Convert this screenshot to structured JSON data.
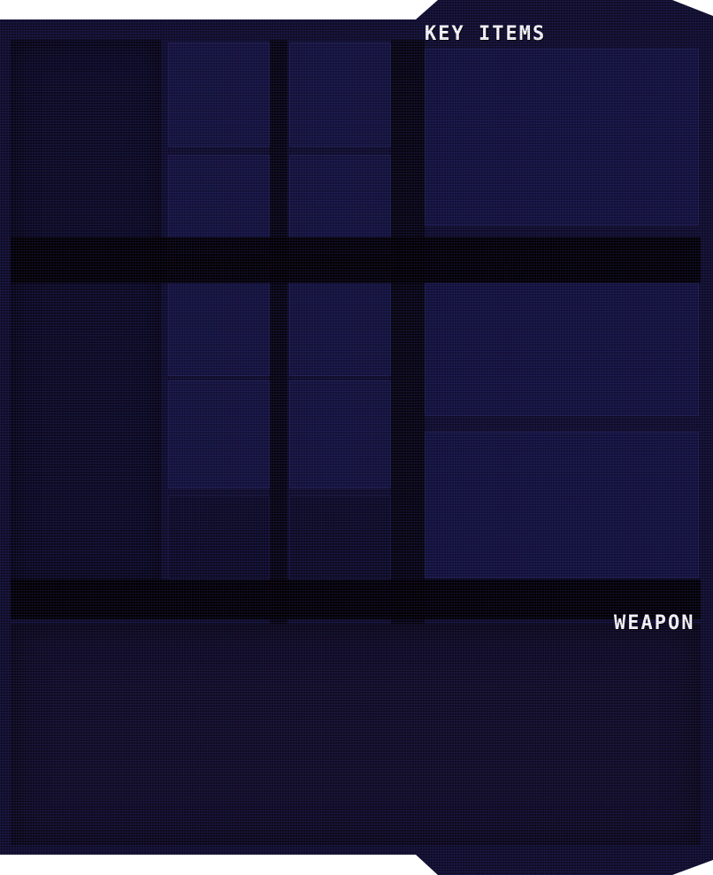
{
  "inventory": {
    "key_items_label": "KEY ITEMS",
    "weapon_label": "WEAPON",
    "colors": {
      "background": "#0d0d2a",
      "slot": "#11123a",
      "label": "#ffffff"
    }
  }
}
